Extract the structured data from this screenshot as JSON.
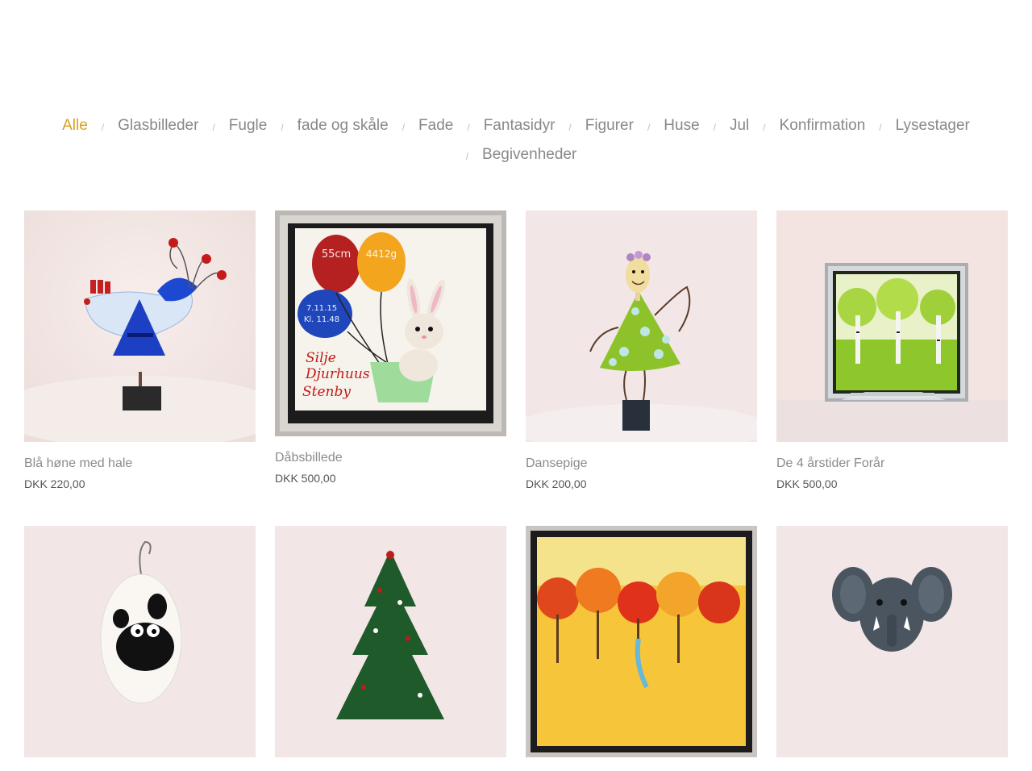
{
  "filters": {
    "row1": [
      "Alle",
      "Glasbilleder",
      "Fugle",
      "fade og skåle",
      "Fade",
      "Fantasidyr",
      "Figurer",
      "Huse",
      "Jul",
      "Konfirmation",
      "Lysestager"
    ],
    "row2": [
      "Begivenheder"
    ],
    "active": "Alle",
    "separator": "/"
  },
  "products": [
    {
      "title": "Blå høne med hale",
      "price": "DKK 220,00"
    },
    {
      "title": "Dåbsbillede",
      "price": "DKK 500,00"
    },
    {
      "title": "Dansepige",
      "price": "DKK 200,00"
    },
    {
      "title": "De 4 årstider Forår",
      "price": "DKK 500,00"
    },
    {
      "title": "",
      "price": ""
    },
    {
      "title": "",
      "price": ""
    },
    {
      "title": "",
      "price": ""
    },
    {
      "title": "",
      "price": ""
    }
  ],
  "artwork_text": {
    "balloon1": "55cm",
    "balloon2": "4412g",
    "balloon3_line1": "7.11.15",
    "balloon3_line2": "Kl. 11.48",
    "name_line1": "Silje",
    "name_line2": "Djurhuus",
    "name_line3": "Stenby"
  },
  "colors": {
    "accent": "#d7a01e",
    "text_muted": "#888888",
    "price": "#555555"
  }
}
